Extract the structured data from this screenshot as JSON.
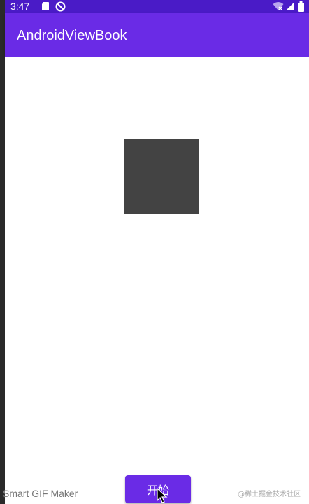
{
  "statusbar": {
    "time": "3:47",
    "icons": [
      "sd-card-icon",
      "no-sync-icon",
      "wifi-icon",
      "signal-icon",
      "battery-icon"
    ]
  },
  "appbar": {
    "title": "AndroidViewBook"
  },
  "main": {
    "start_button_label": "开始"
  },
  "watermarks": {
    "left": "Smart GIF Maker",
    "right": "@稀土掘金技术社区"
  },
  "colors": {
    "status_bar": "#4a1bc7",
    "app_bar": "#6a2be6",
    "button": "#6a2be6",
    "square": "#434343"
  }
}
